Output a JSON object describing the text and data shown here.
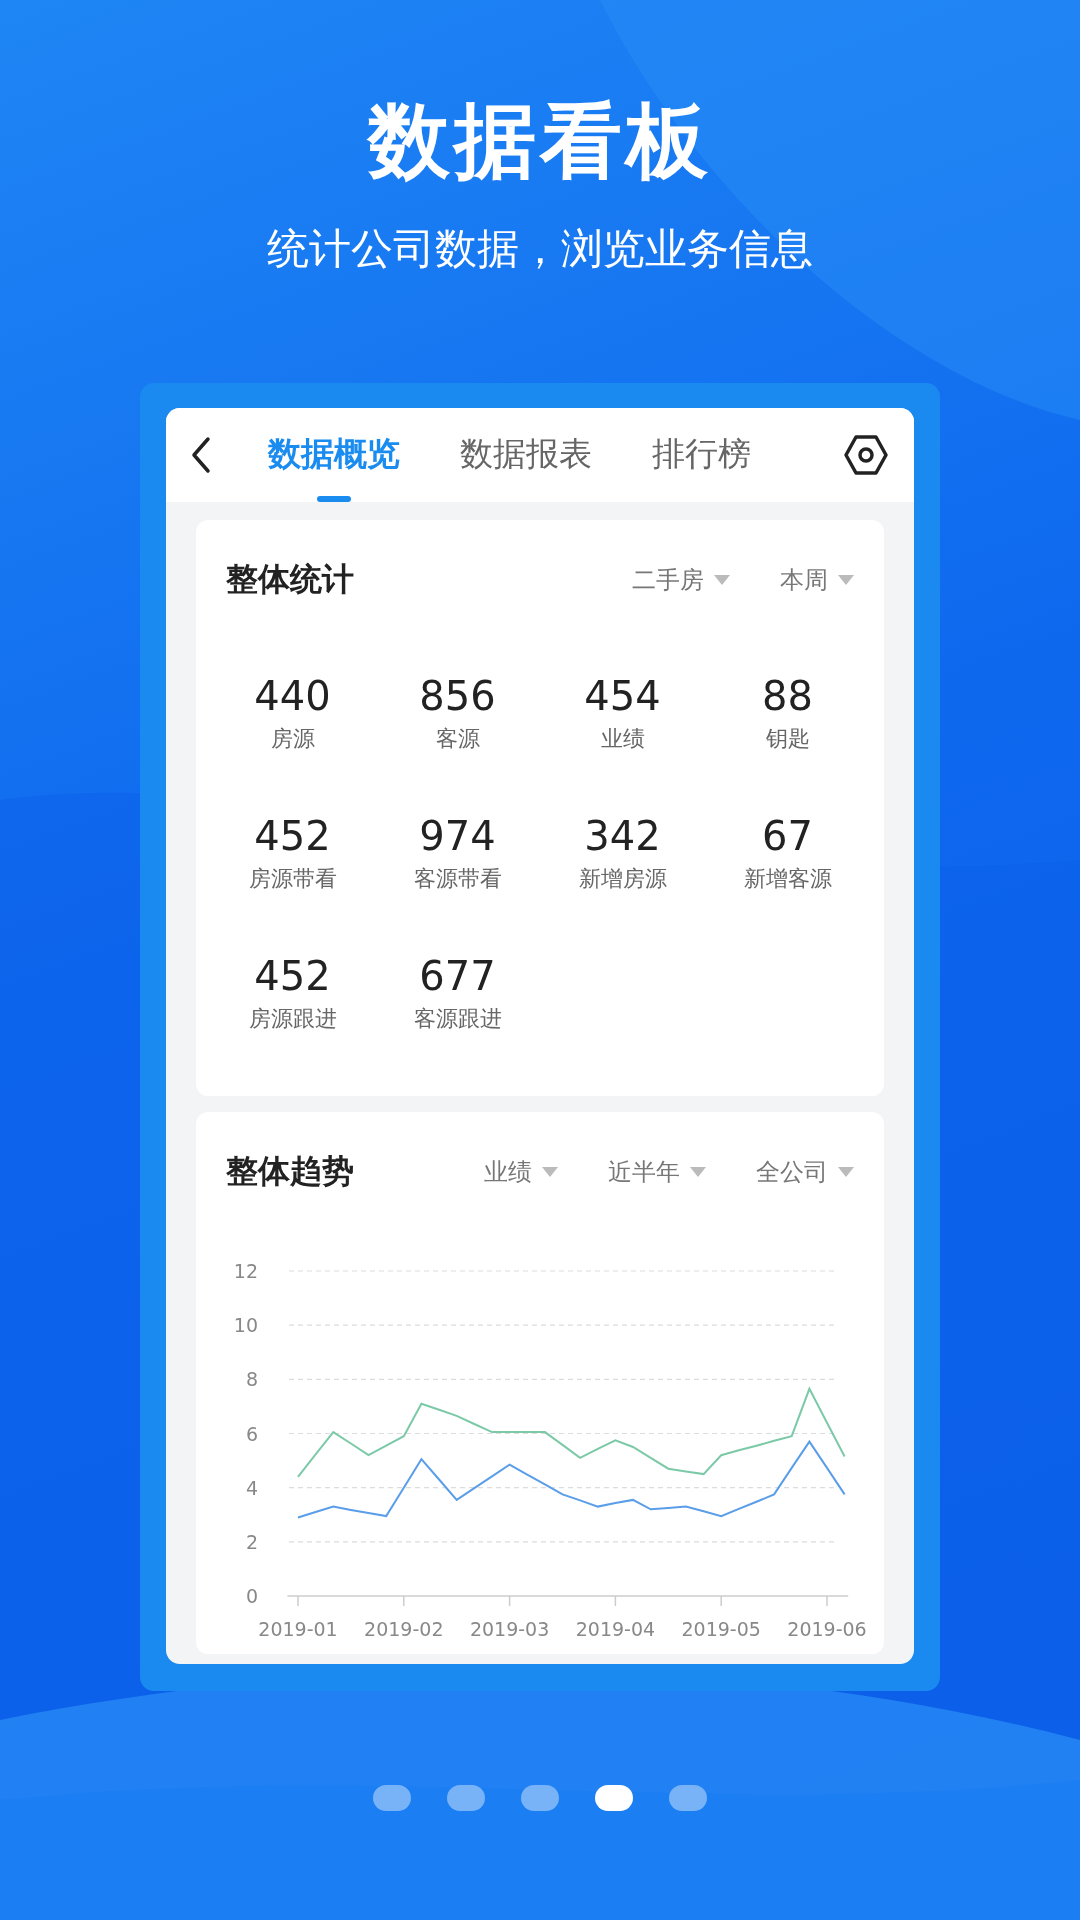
{
  "headline": "数据看板",
  "subline": "统计公司数据，浏览业务信息",
  "app": {
    "tabs": [
      {
        "label": "数据概览",
        "selected": true
      },
      {
        "label": "数据报表",
        "selected": false
      },
      {
        "label": "排行榜",
        "selected": false
      }
    ],
    "overview": {
      "title": "整体统计",
      "filters": [
        "二手房",
        "本周"
      ],
      "stats": [
        {
          "value": "440",
          "label": "房源"
        },
        {
          "value": "856",
          "label": "客源"
        },
        {
          "value": "454",
          "label": "业绩"
        },
        {
          "value": "88",
          "label": "钥匙"
        },
        {
          "value": "452",
          "label": "房源带看"
        },
        {
          "value": "974",
          "label": "客源带看"
        },
        {
          "value": "342",
          "label": "新增房源"
        },
        {
          "value": "67",
          "label": "新增客源"
        },
        {
          "value": "452",
          "label": "房源跟进"
        },
        {
          "value": "677",
          "label": "客源跟进"
        }
      ]
    },
    "trend": {
      "title": "整体趋势",
      "filters": [
        "业绩",
        "近半年",
        "全公司"
      ],
      "chart_data": {
        "type": "line",
        "grid": true,
        "ylim": [
          0,
          12
        ],
        "yticks": [
          0,
          2,
          4,
          6,
          8,
          10,
          12
        ],
        "categories": [
          "2019-01",
          null,
          null,
          null,
          null,
          null,
          "2019-02",
          null,
          null,
          null,
          null,
          null,
          "2019-03",
          null,
          null,
          null,
          null,
          null,
          "2019-04",
          null,
          null,
          null,
          null,
          null,
          "2019-05",
          null,
          null,
          null,
          null,
          null,
          "2019-06",
          null
        ],
        "series": [
          {
            "color": "#7cc9a8",
            "values": [
              4.4,
              5.23,
              6.05,
              5.63,
              5.2,
              5.55,
              5.9,
              7.1,
              6.88,
              6.65,
              6.35,
              6.05,
              6.05,
              6.05,
              6.05,
              5.58,
              5.1,
              5.43,
              5.75,
              5.5,
              5.1,
              4.7,
              4.6,
              4.5,
              5.2,
              5.38,
              5.55,
              5.73,
              5.9,
              7.65,
              6.4,
              5.15
            ]
          },
          {
            "color": "#5a9de8",
            "values": [
              2.9,
              3.1,
              3.3,
              3.18,
              3.07,
              2.95,
              4.0,
              5.05,
              4.3,
              3.55,
              3.98,
              4.42,
              4.85,
              4.48,
              4.12,
              3.75,
              3.53,
              3.3,
              3.43,
              3.55,
              3.2,
              3.25,
              3.3,
              3.13,
              2.95,
              3.22,
              3.48,
              3.75,
              4.73,
              5.7,
              4.73,
              3.75
            ]
          }
        ]
      }
    }
  },
  "pager": [
    {
      "selected": false
    },
    {
      "selected": false
    },
    {
      "selected": false
    },
    {
      "selected": true
    },
    {
      "selected": false
    }
  ]
}
